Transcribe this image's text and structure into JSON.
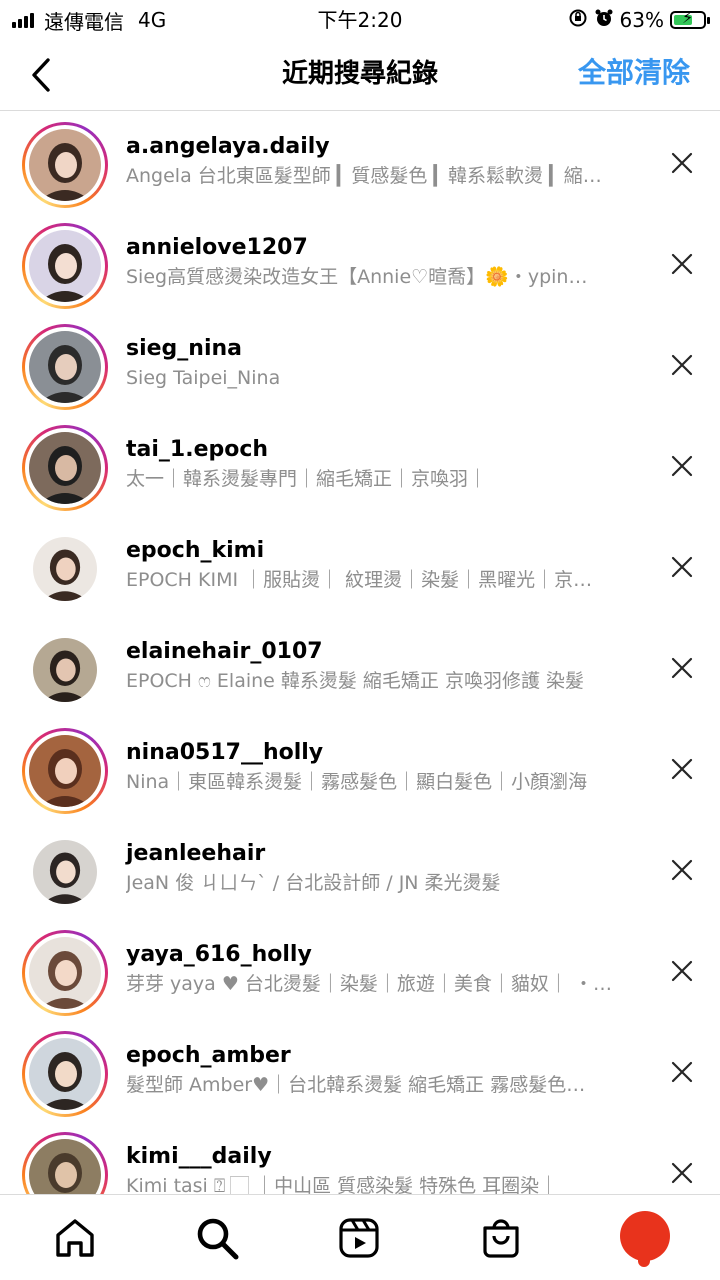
{
  "status_bar": {
    "carrier": "遠傳電信",
    "network": "4G",
    "time": "下午2:20",
    "battery_pct": "63%",
    "battery_level": 0.63,
    "icons": [
      "signal-icon",
      "rotation-lock-icon",
      "alarm-icon",
      "battery-icon"
    ]
  },
  "header": {
    "title": "近期搜尋紀錄",
    "clear_all": "全部清除",
    "accent_color": "#3897f0"
  },
  "results": [
    {
      "username": "a.angelaya.daily",
      "subtitle": "Angela 台北東區髮型師 ▎質感髮色 ▎韓系鬆軟燙 ▎縮…",
      "story": true
    },
    {
      "username": "annielove1207",
      "subtitle": "Sieg高質感燙染改造女王【Annie♡暄喬】🌼・ypin…",
      "story": true
    },
    {
      "username": "sieg_nina",
      "subtitle": "Sieg Taipei_Nina",
      "story": true
    },
    {
      "username": "tai_1.epoch",
      "subtitle": "太一｜韓系燙髮專門｜縮毛矯正｜京喚羽｜",
      "story": true
    },
    {
      "username": "epoch_kimi",
      "subtitle": "EPOCH KIMI ｜服貼燙｜ 紋理燙｜染髮｜黑曜光｜京…",
      "story": false
    },
    {
      "username": "elainehair_0107",
      "subtitle": "EPOCH ෆ Elaine 韓系燙髮 縮毛矯正 京喚羽修護 染髮",
      "story": false
    },
    {
      "username": "nina0517__holly",
      "subtitle": "Nina｜東區韓系燙髮｜霧感髮色｜顯白髮色｜小顏瀏海",
      "story": true
    },
    {
      "username": "jeanleehair",
      "subtitle": "JeaN 俊 ㄐㄩㄣˋ / 台北設計師 / JN 柔光燙髮",
      "story": false
    },
    {
      "username": "yaya_616_holly",
      "subtitle": "芽芽 yaya ♥ 台北燙髮｜染髮｜旅遊｜美食｜貓奴｜ ・…",
      "story": true
    },
    {
      "username": "epoch_amber",
      "subtitle": "髮型師 Amber♥｜台北韓系燙髮 縮毛矯正 霧感髮色…",
      "story": true
    },
    {
      "username": "kimi___daily",
      "subtitle": "Kimi tasi ⍰ 🏻 ｜中山區 質感染髮 特殊色 耳圈染｜",
      "story": true
    }
  ],
  "tabs": [
    {
      "name": "home-tab",
      "icon": "home-icon"
    },
    {
      "name": "search-tab",
      "icon": "search-icon"
    },
    {
      "name": "reels-tab",
      "icon": "reels-icon"
    },
    {
      "name": "shop-tab",
      "icon": "shopping-bag-icon"
    },
    {
      "name": "profile-tab",
      "icon": "profile-avatar"
    }
  ]
}
